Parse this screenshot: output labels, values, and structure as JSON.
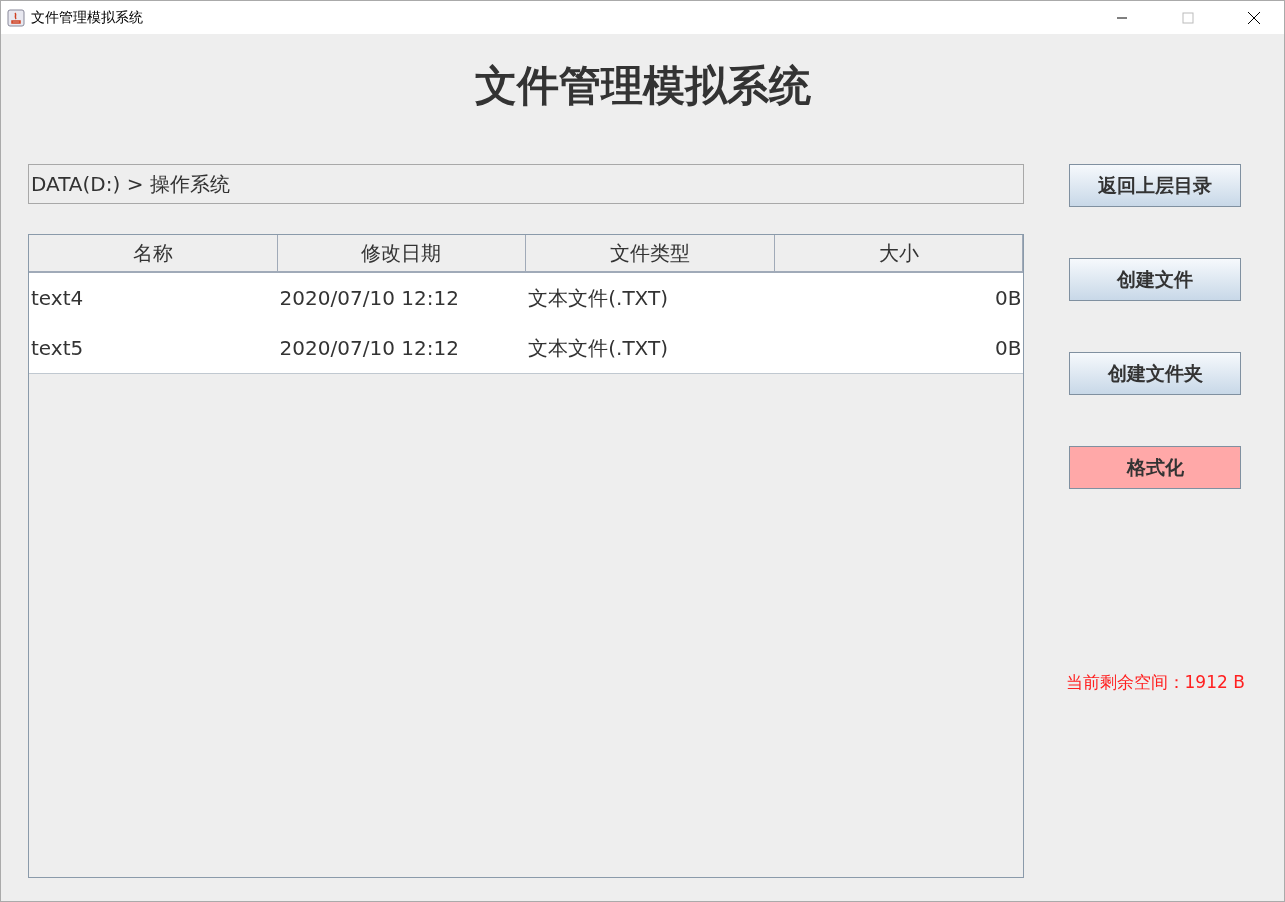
{
  "window": {
    "title": "文件管理模拟系统"
  },
  "heading": "文件管理模拟系统",
  "path": "DATA(D:) > 操作系统",
  "table": {
    "columns": [
      "名称",
      "修改日期",
      "文件类型",
      "大小"
    ],
    "rows": [
      {
        "cells": [
          "text4",
          "2020/07/10 12:12",
          "文本文件(.TXT)",
          "0B"
        ]
      },
      {
        "cells": [
          "text5",
          "2020/07/10 12:12",
          "文本文件(.TXT)",
          "0B"
        ]
      }
    ]
  },
  "buttons": [
    {
      "label": "返回上层目录",
      "kind": "normal"
    },
    {
      "label": "创建文件",
      "kind": "normal"
    },
    {
      "label": "创建文件夹",
      "kind": "normal"
    },
    {
      "label": "格式化",
      "kind": "danger"
    }
  ],
  "free_space": "当前剩余空间：1912 B"
}
